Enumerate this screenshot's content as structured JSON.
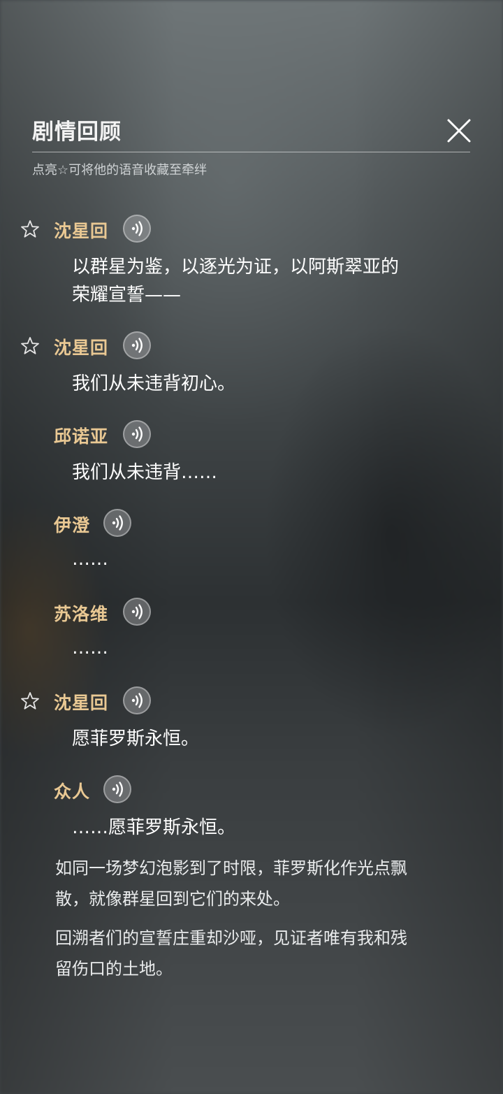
{
  "header": {
    "title": "剧情回顾",
    "subtitle": "点亮☆可将他的语音收藏至牵绊",
    "close_icon": "close-icon"
  },
  "colors": {
    "speaker": "#e9c893",
    "text": "#ffffff",
    "narration": "#e9ebec"
  },
  "dialogue": [
    {
      "speaker": "沈星回",
      "text_1": "以群星为鉴，以逐光为证，以阿斯翠亚的",
      "text_2": "荣耀宣誓——",
      "favoritable": true
    },
    {
      "speaker": "沈星回",
      "text_1": "我们从未违背初心。",
      "favoritable": true
    },
    {
      "speaker": "邱诺亚",
      "text_1": "我们从未违背……",
      "favoritable": false
    },
    {
      "speaker": "伊澄",
      "text_1": "……",
      "favoritable": false
    },
    {
      "speaker": "苏洛维",
      "text_1": "……",
      "favoritable": false
    },
    {
      "speaker": "沈星回",
      "text_1": "愿菲罗斯永恒。",
      "favoritable": true
    },
    {
      "speaker": "众人",
      "text_1": "……愿菲罗斯永恒。",
      "favoritable": false
    }
  ],
  "narration": [
    {
      "line_1": "如同一场梦幻泡影到了时限，菲罗斯化作光点飘",
      "line_2": "散，就像群星回到它们的来处。"
    },
    {
      "line_1": "回溯者们的宣誓庄重却沙哑，见证者唯有我和残",
      "line_2": "留伤口的土地。"
    }
  ]
}
